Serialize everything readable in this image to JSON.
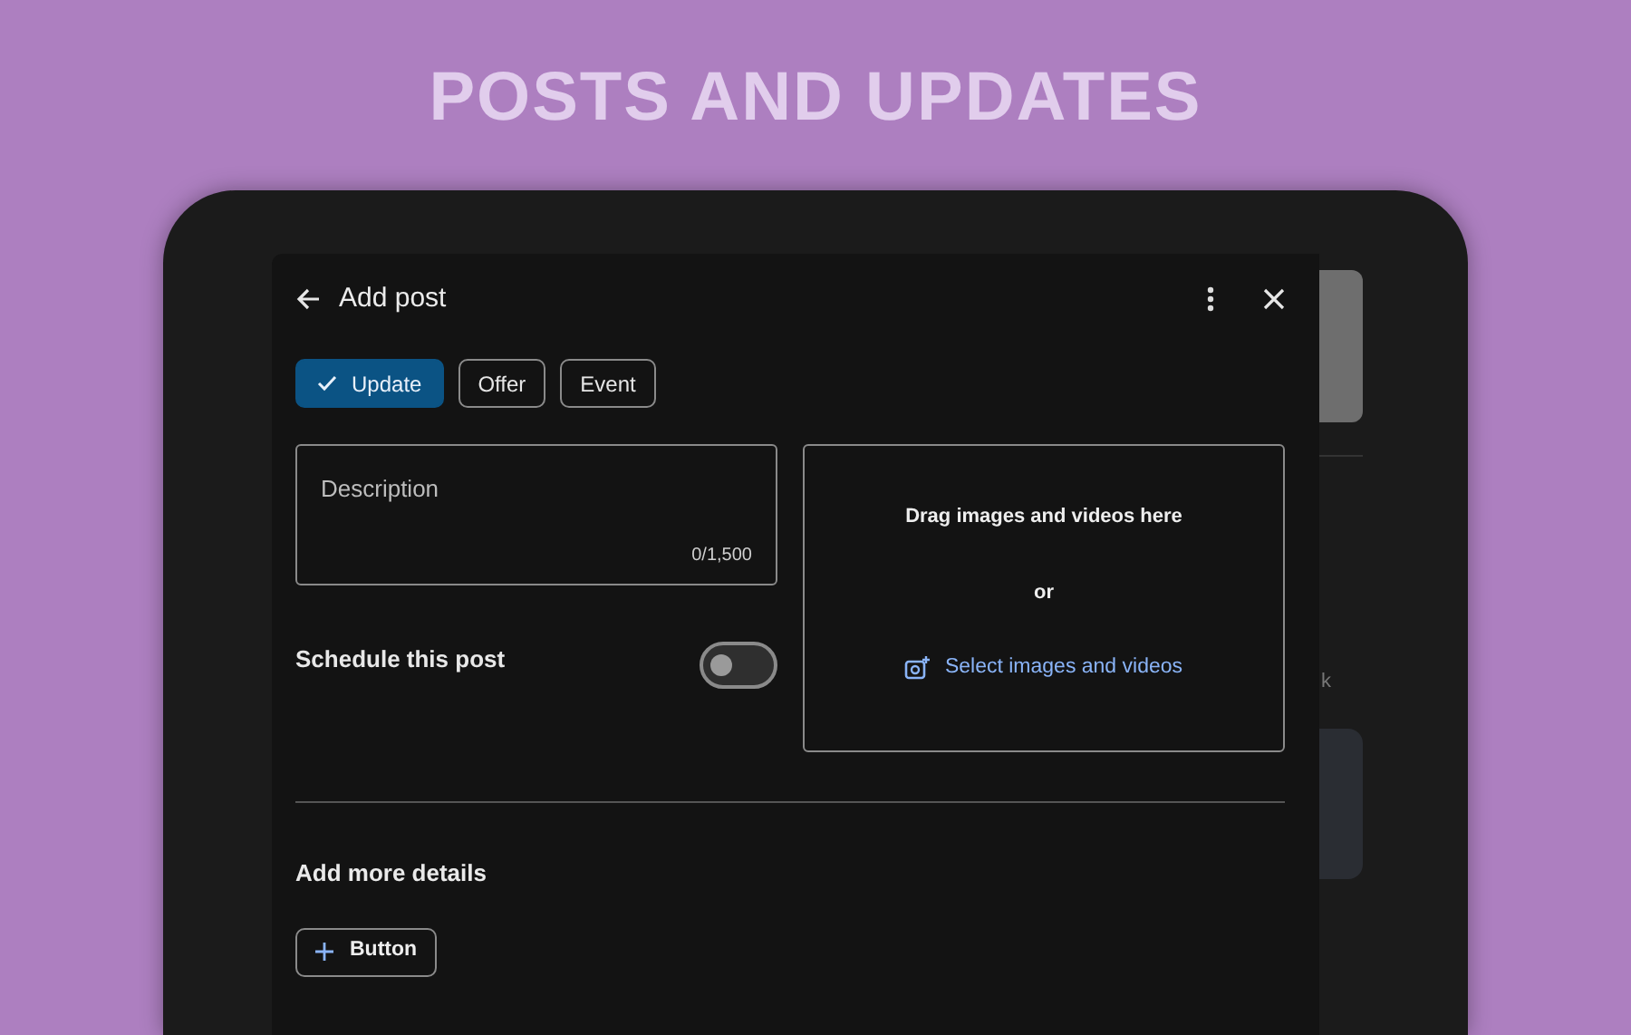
{
  "banner": {
    "title": "POSTS AND UPDATES"
  },
  "background": {
    "partial_label": "k"
  },
  "dialog": {
    "title": "Add post",
    "post_types": [
      {
        "label": "Update",
        "selected": true
      },
      {
        "label": "Offer",
        "selected": false
      },
      {
        "label": "Event",
        "selected": false
      }
    ],
    "description": {
      "placeholder": "Description",
      "counter": "0/1,500"
    },
    "schedule": {
      "label": "Schedule this post",
      "on": false
    },
    "media": {
      "drop_text": "Drag images and videos here",
      "or_text": "or",
      "select_link": "Select images and videos"
    },
    "more_details": {
      "heading": "Add more details",
      "add_button": "Button"
    }
  }
}
